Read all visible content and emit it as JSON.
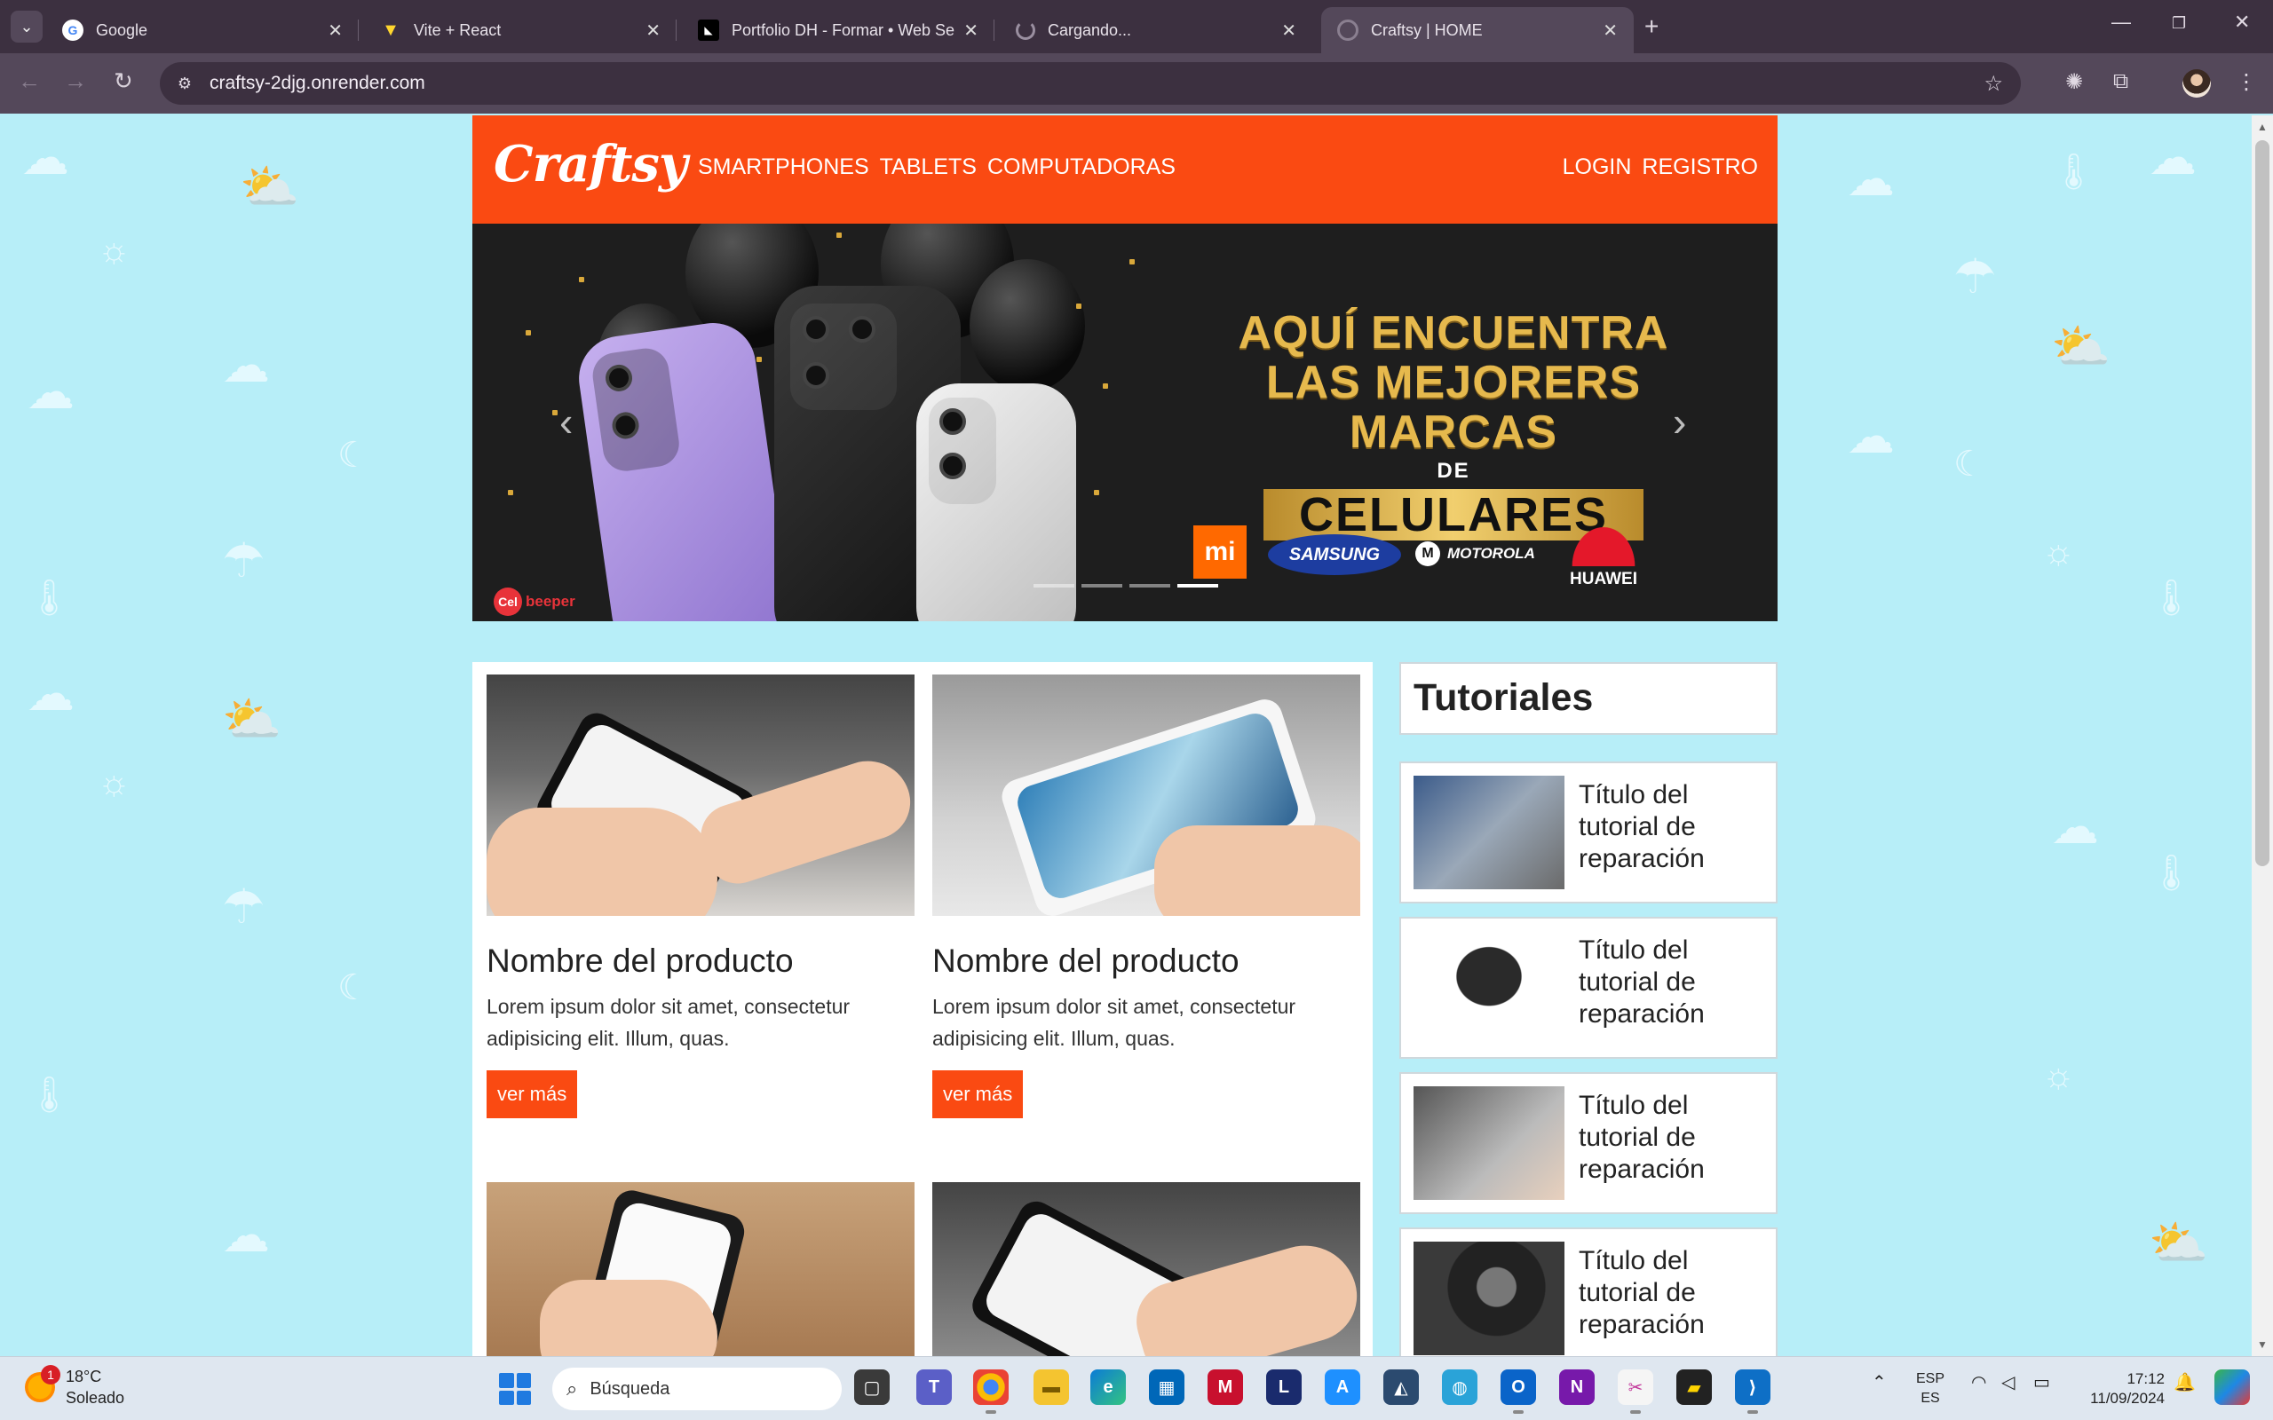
{
  "browser": {
    "tabs": [
      {
        "title": "Google",
        "icon": "google-icon",
        "active": false
      },
      {
        "title": "Vite + React",
        "icon": "vite-icon",
        "active": false
      },
      {
        "title": "Portfolio DH - Formar • Web Se",
        "icon": "portfolio-icon",
        "active": false
      },
      {
        "title": "Cargando...",
        "icon": "loading-icon",
        "active": false
      },
      {
        "title": "Craftsy | HOME",
        "icon": "craftsy-icon",
        "active": true
      }
    ],
    "url": "craftsy-2djg.onrender.com",
    "icons": [
      "back-icon",
      "forward-icon",
      "reload-icon",
      "site-info-icon",
      "bookmark-star-icon",
      "extension-icon",
      "puzzle-icon",
      "profile-avatar",
      "menu-icon"
    ]
  },
  "site": {
    "logo": "Craftsy",
    "nav": [
      "SMARTPHONES",
      "TABLETS",
      "COMPUTADORAS"
    ],
    "auth": [
      "LOGIN",
      "REGISTRO"
    ],
    "accent": "#fa4a12",
    "carousel": {
      "line1": "AQUÍ ENCUENTRA",
      "line2": "LAS MEJORERS MARCAS",
      "line3": "DE",
      "line4": "CELULARES",
      "brands": {
        "xiaomi": "mi",
        "samsung": "SAMSUNG",
        "motorola": "MOTOROLA",
        "huawei": "HUAWEI"
      },
      "watermark": "Cel",
      "watermark_rest": "beeper",
      "slides": 4,
      "active_slide": 4
    },
    "products": [
      {
        "name": "Nombre del producto",
        "desc": "Lorem ipsum dolor sit amet, consectetur adipisicing elit. Illum, quas.",
        "button": "ver más"
      },
      {
        "name": "Nombre del producto",
        "desc": "Lorem ipsum dolor sit amet, consectetur adipisicing elit. Illum, quas.",
        "button": "ver más"
      }
    ],
    "tutorials": {
      "heading": "Tutoriales",
      "items": [
        {
          "title": "Título del tutorial de reparación"
        },
        {
          "title": "Título del tutorial de reparación"
        },
        {
          "title": "Título del tutorial de reparación"
        },
        {
          "title": "Título del tutorial de reparación"
        }
      ]
    }
  },
  "taskbar": {
    "weather_temp": "18°C",
    "weather_desc": "Soleado",
    "weather_badge": "1",
    "search_placeholder": "Búsqueda",
    "lang_top": "ESP",
    "lang_bottom": "ES",
    "time": "17:12",
    "date": "11/09/2024",
    "pinned_letters": {
      "lexicon": "L",
      "onenote": "N"
    }
  }
}
